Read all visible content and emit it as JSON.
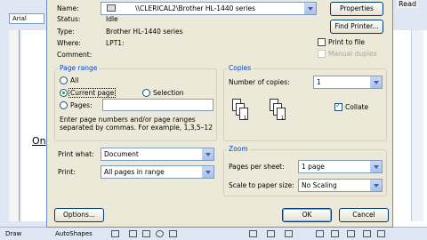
{
  "word": {
    "font_name": "Arial",
    "read_label": "Read",
    "body_text": "On",
    "draw_label": "Draw",
    "autoshapes_label": "AutoShapes"
  },
  "printer": {
    "name_label": "Name:",
    "name_value": "\\\\CLERICAL2\\Brother HL-1440 series",
    "status_label": "Status:",
    "status_value": "Idle",
    "type_label": "Type:",
    "type_value": "Brother HL-1440 series",
    "where_label": "Where:",
    "where_value": "LPT1:",
    "comment_label": "Comment:",
    "properties_btn": "Properties",
    "find_printer_btn": "Find Printer...",
    "print_to_file": "Print to file",
    "manual_duplex": "Manual duplex"
  },
  "page_range": {
    "title": "Page range",
    "all": "All",
    "current_page": "Current page",
    "selection": "Selection",
    "pages": "Pages:",
    "help": "Enter page numbers and/or page ranges separated by commas. For example, 1,3,5–12"
  },
  "copies": {
    "title": "Copies",
    "number_label": "Number of copies:",
    "number_value": "1",
    "collate": "Collate"
  },
  "print_what": {
    "label": "Print what:",
    "value": "Document"
  },
  "print": {
    "label": "Print:",
    "value": "All pages in range"
  },
  "zoom": {
    "title": "Zoom",
    "pages_per_sheet_label": "Pages per sheet:",
    "pages_per_sheet_value": "1 page",
    "scale_label": "Scale to paper size:",
    "scale_value": "No Scaling"
  },
  "buttons": {
    "options": "Options...",
    "ok": "OK",
    "cancel": "Cancel"
  }
}
